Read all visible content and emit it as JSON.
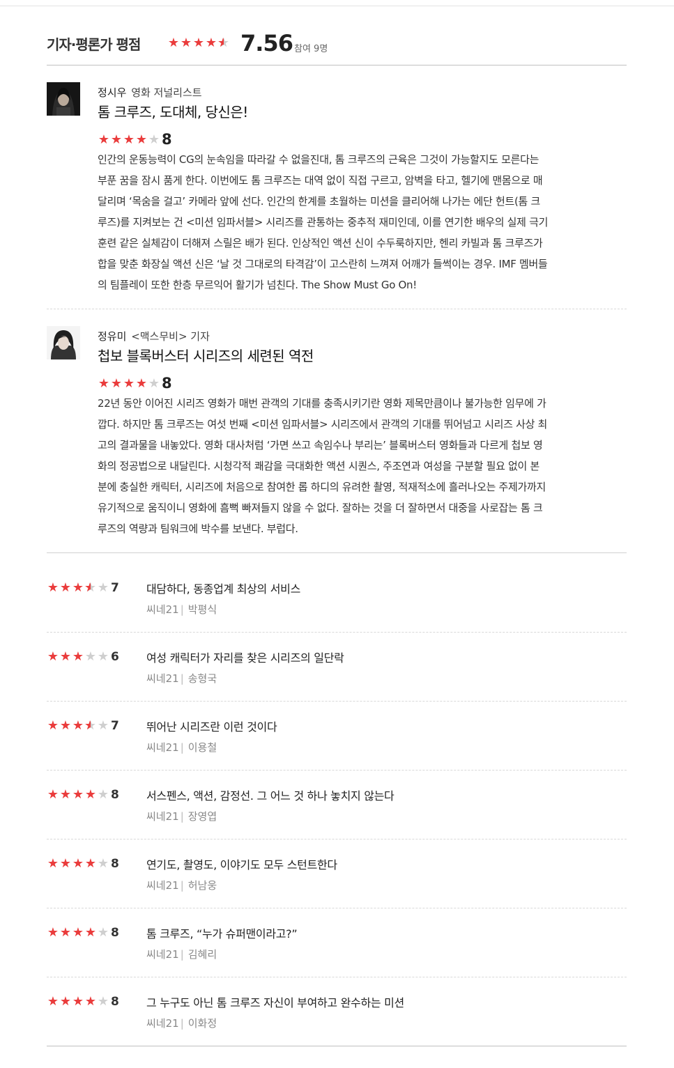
{
  "header": {
    "title": "기자·평론가 평점",
    "score": "7.56",
    "participants": "참여 9명",
    "stars": [
      1,
      1,
      1,
      1,
      0.5
    ]
  },
  "critics": [
    {
      "name": "정시우",
      "role": "영화 저널리스트",
      "headline": "톰 크루즈, 도대체, 당신은!",
      "score": "8",
      "stars": [
        1,
        1,
        1,
        1,
        0
      ],
      "avatar": "dark",
      "lines": [
        "인간의 운동능력이 CG의 눈속임을 따라갈 수 없을진대, 톰 크루즈의 근육은 그것이 가능할지도 모른다는",
        "부푼 꿈을 잠시 품게 한다. 이번에도 톰 크루즈는 대역 없이 직접 구르고, 암벽을 타고, 헬기에 맨몸으로 매",
        "달리며 ‘목숨을 걸고’ 카메라 앞에 선다. 인간의 한계를 초월하는 미션을 클리어해 나가는 에단 헌트(톰 크",
        "루즈)를 지켜보는 건 <미션 임파서블> 시리즈를 관통하는 중추적 재미인데, 이를 연기한 배우의 실제 극기",
        "훈련 같은 실체감이 더해져 스릴은 배가 된다. 인상적인 액션 신이 수두룩하지만, 헨리 카빌과 톰 크루즈가",
        "합을 맞춘 화장실 액션 신은 ‘날 것 그대로의 타격감’이 고스란히 느껴져 어깨가 들썩이는 경우. IMF 멤버들",
        "의 팀플레이 또한 한층 무르익어 활기가 넘친다. The Show Must Go On!"
      ]
    },
    {
      "name": "정유미",
      "role": "<맥스무비> 기자",
      "headline": "첩보 블록버스터 시리즈의 세련된 역전",
      "score": "8",
      "stars": [
        1,
        1,
        1,
        1,
        0
      ],
      "avatar": "light",
      "lines": [
        "22년 동안 이어진 시리즈 영화가 매번 관객의 기대를 충족시키기란 영화 제목만큼이나 불가능한 임무에 가",
        "깝다. 하지만 톰 크루즈는 여섯 번째 <미션 임파서블> 시리즈에서 관객의 기대를 뛰어넘고 시리즈 사상 최",
        "고의 결과물을 내놓았다. 영화 대사처럼 ‘가면 쓰고 속임수나 부리는’ 블록버스터 영화들과 다르게 첩보 영",
        "화의 정공법으로 내달린다. 시청각적 쾌감을 극대화한 액션 시퀀스, 주조연과 여성을 구분할 필요 없이 본",
        "분에 충실한 캐릭터, 시리즈에 처음으로 참여한 롭 하디의 유려한 촬영, 적재적소에 흘러나오는 주제가까지",
        "유기적으로 움직이니 영화에 흠뻑 빠져들지 않을 수 없다. 잘하는 것을 더 잘하면서 대중을 사로잡는 톰 크",
        "루즈의 역량과 팀워크에 박수를 보낸다. 부럽다."
      ]
    }
  ],
  "short_reviews": [
    {
      "score": "7",
      "stars": [
        1,
        1,
        1,
        0.5,
        0
      ],
      "comment": "대담하다, 동종업계 최상의 서비스",
      "outlet": "씨네21",
      "name": "박평식"
    },
    {
      "score": "6",
      "stars": [
        1,
        1,
        1,
        0,
        0
      ],
      "comment": "여성 캐릭터가 자리를 찾은 시리즈의 일단락",
      "outlet": "씨네21",
      "name": "송형국"
    },
    {
      "score": "7",
      "stars": [
        1,
        1,
        1,
        0.5,
        0
      ],
      "comment": "뛰어난 시리즈란 이런 것이다",
      "outlet": "씨네21",
      "name": "이용철"
    },
    {
      "score": "8",
      "stars": [
        1,
        1,
        1,
        1,
        0
      ],
      "comment": "서스펜스, 액션, 감정선. 그 어느 것 하나 놓치지 않는다",
      "outlet": "씨네21",
      "name": "장영엽"
    },
    {
      "score": "8",
      "stars": [
        1,
        1,
        1,
        1,
        0
      ],
      "comment": "연기도, 촬영도, 이야기도 모두 스턴트한다",
      "outlet": "씨네21",
      "name": "허남웅"
    },
    {
      "score": "8",
      "stars": [
        1,
        1,
        1,
        1,
        0
      ],
      "comment": "톰 크루즈, “누가 슈퍼맨이라고?”",
      "outlet": "씨네21",
      "name": "김혜리"
    },
    {
      "score": "8",
      "stars": [
        1,
        1,
        1,
        1,
        0
      ],
      "comment": "그 누구도 아닌 톰 크루즈 자신이 부여하고 완수하는 미션",
      "outlet": "씨네21",
      "name": "이화정"
    }
  ],
  "colors": {
    "star_on": "#ea3c3c",
    "star_off": "#cfcfcf"
  }
}
